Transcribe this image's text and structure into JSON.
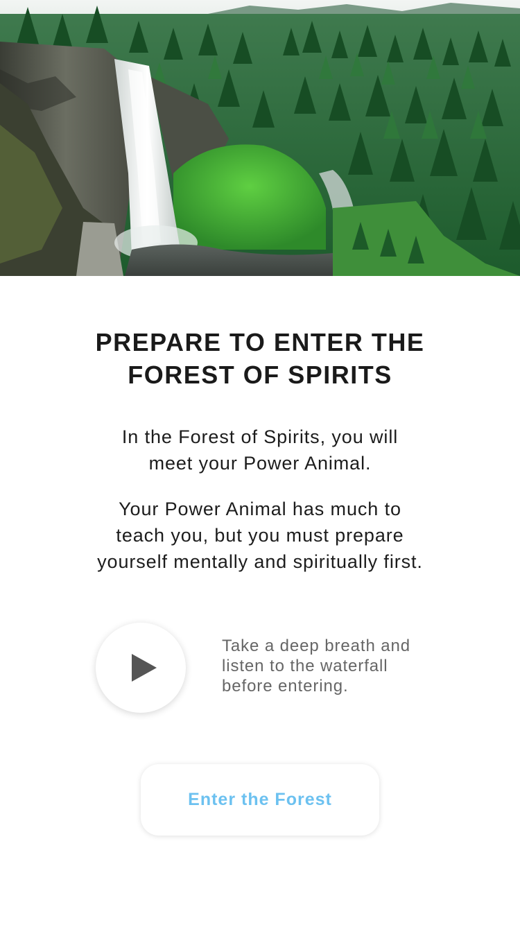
{
  "hero": {
    "icon": "waterfall-forest-image"
  },
  "title": {
    "line1": "PREPARE TO ENTER THE",
    "line2": "FOREST OF SPIRITS"
  },
  "intro": {
    "line1": "In the Forest of Spirits, you will",
    "line2": "meet your Power Animal."
  },
  "details": {
    "line1": "Your Power Animal has much to",
    "line2": "teach you, but you must prepare",
    "line3": "yourself mentally and spiritually first."
  },
  "audio": {
    "icon": "play-icon",
    "caption_line1": "Take a deep breath and",
    "caption_line2": "listen to the waterfall",
    "caption_line3": "before entering."
  },
  "enter_button": {
    "label": "Enter the Forest"
  },
  "colors": {
    "title": "#1a1a1a",
    "body": "#1c1c1c",
    "caption": "#666666",
    "button_text": "#6cc1f0",
    "play_icon": "#555555"
  }
}
